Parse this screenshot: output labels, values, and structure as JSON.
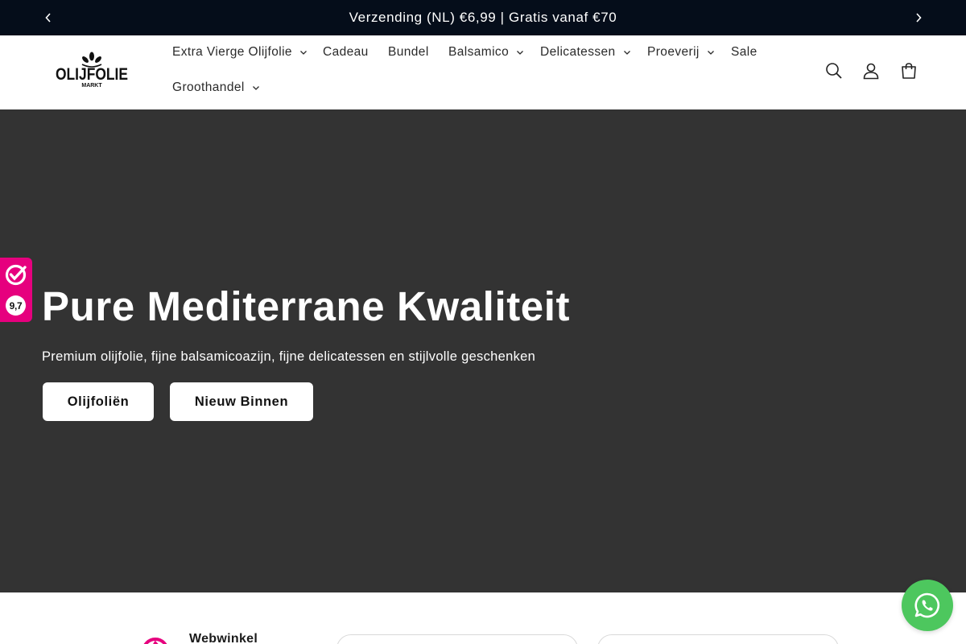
{
  "announcement": {
    "text": "Verzending (NL) €6,99 | Gratis vanaf €70"
  },
  "logo": {
    "name": "OLIJFOLIE",
    "tagline": "MARKT"
  },
  "nav": {
    "items": [
      {
        "label": "Extra Vierge Olijfolie",
        "dropdown": true
      },
      {
        "label": "Cadeau",
        "dropdown": false
      },
      {
        "label": "Bundel",
        "dropdown": false
      },
      {
        "label": "Balsamico",
        "dropdown": true
      },
      {
        "label": "Delicatessen",
        "dropdown": true
      },
      {
        "label": "Proeverij",
        "dropdown": true
      },
      {
        "label": "Sale",
        "dropdown": false
      },
      {
        "label": "Groothandel",
        "dropdown": true
      }
    ]
  },
  "header_icons": [
    "search-icon",
    "account-icon",
    "cart-icon"
  ],
  "hero": {
    "title": "Pure Mediterrane Kwaliteit",
    "subtitle": "Premium olijfolie, fijne balsamicoazijn, fijne delicatessen en stijlvolle geschenken",
    "buttons": [
      {
        "label": "Olijfoliën"
      },
      {
        "label": "Nieuw Binnen"
      }
    ],
    "background": "#333333"
  },
  "rating_badge": {
    "score": "9,7",
    "color": "#e6007e"
  },
  "footer_band": {
    "webwinkel_label": "Webwinkel"
  },
  "colors": {
    "announcement_bg": "#050d1a",
    "accent_pink": "#e6007e",
    "whatsapp_green": "#4dc75e"
  }
}
